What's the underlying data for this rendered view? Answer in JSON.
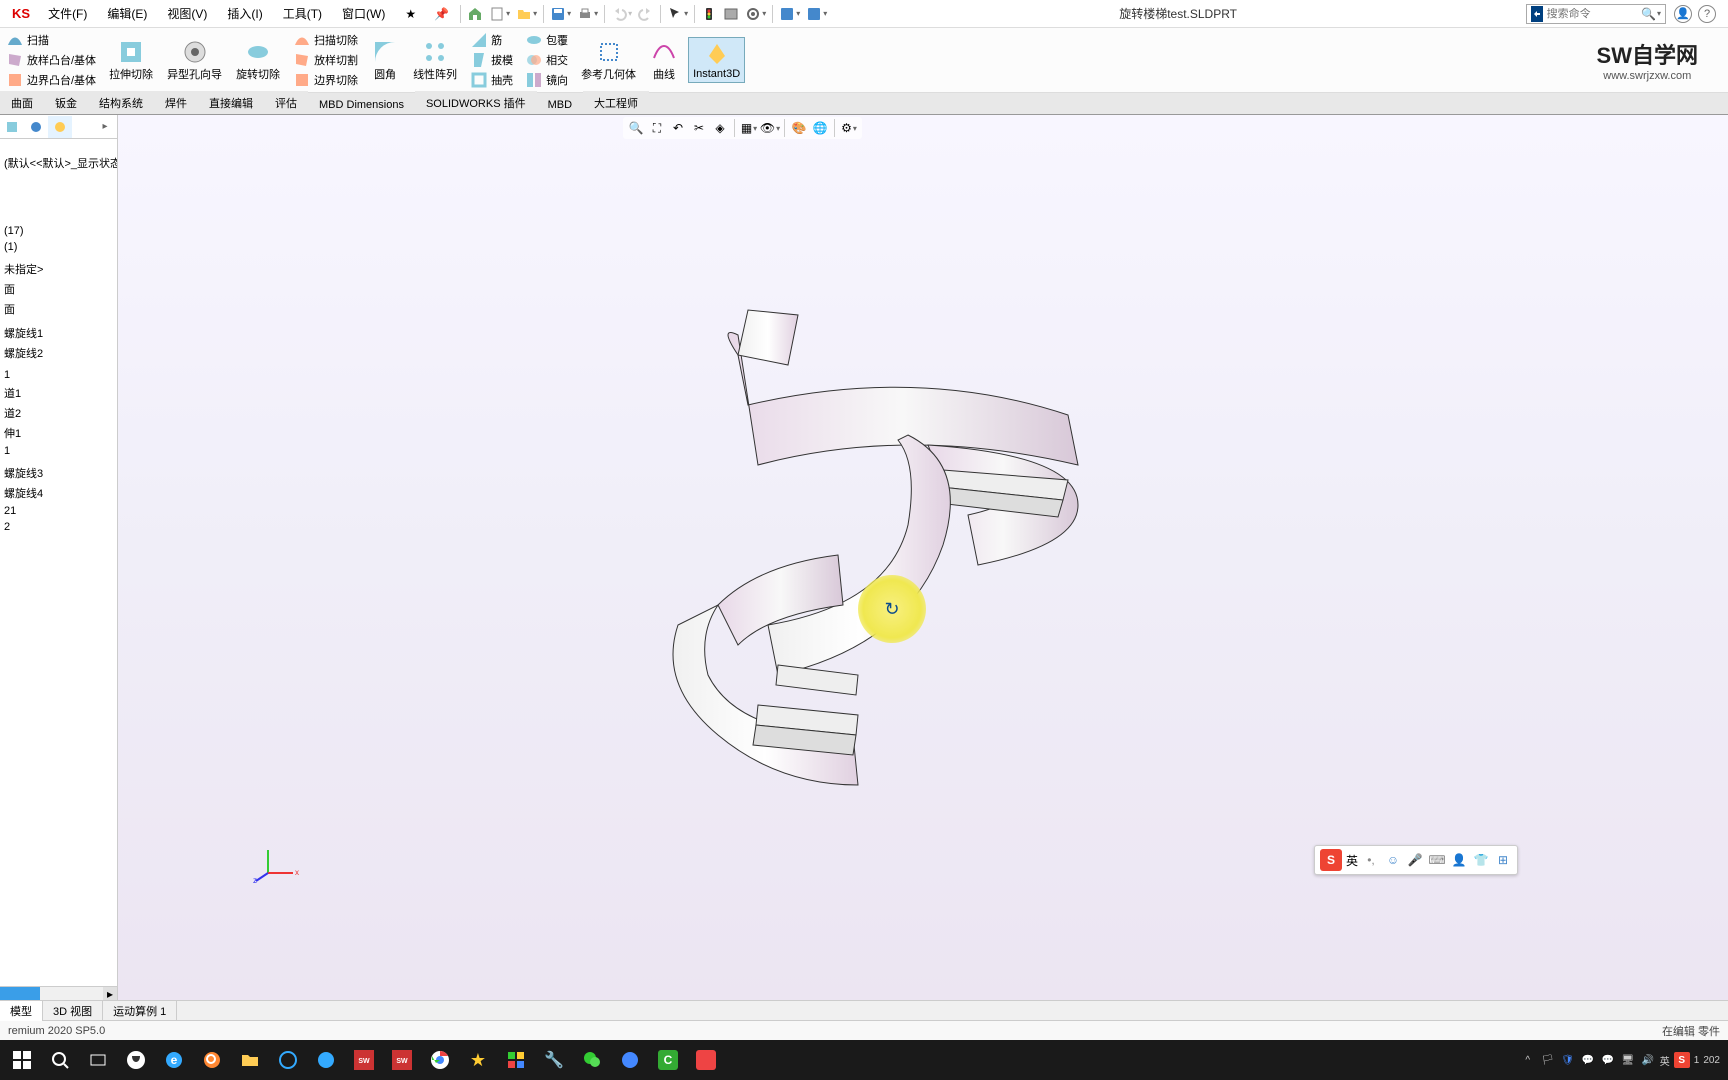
{
  "app": {
    "logo": "KS",
    "doc_title": "旋转楼梯test.SLDPRT"
  },
  "menubar": [
    "文件(F)",
    "编辑(E)",
    "视图(V)",
    "插入(I)",
    "工具(T)",
    "窗口(W)"
  ],
  "search": {
    "placeholder": "搜索命令"
  },
  "ribbon": {
    "r1c1": "扫描",
    "r1c2": "放样凸台/基体",
    "r1c3": "边界凸台/基体",
    "r2c1": "拉伸切除",
    "r2c2": "异型孔向导",
    "r2c3": "旋转切除",
    "r3c1": "扫描切除",
    "r3c2": "放样切割",
    "r3c3": "边界切除",
    "r4c1": "圆角",
    "r4c2": "线性阵列",
    "r5c1": "筋",
    "r5c2": "拔模",
    "r5c3": "抽壳",
    "r6c1": "包覆",
    "r6c2": "相交",
    "r6c3": "镜向",
    "r7": "参考几何体",
    "r8": "曲线",
    "r9": "Instant3D"
  },
  "brand": {
    "t1": "SW自学网",
    "t2": "www.swrjzxw.com"
  },
  "tabs": [
    "曲面",
    "钣金",
    "结构系统",
    "焊件",
    "直接编辑",
    "评估",
    "MBD Dimensions",
    "SOLIDWORKS 插件",
    "MBD",
    "大工程师"
  ],
  "tree": {
    "config": "(默认<<默认>_显示状态",
    "items": [
      "(17)",
      "(1)",
      "",
      "未指定>",
      "面",
      "面",
      "",
      "螺旋线1",
      "螺旋线2",
      "",
      "1",
      "道1",
      "道2",
      "伸1",
      "1",
      "",
      "螺旋线3",
      "螺旋线4",
      "21",
      "2",
      ""
    ]
  },
  "bottom_tabs": [
    "模型",
    "3D 视图",
    "运动算例 1"
  ],
  "status": {
    "left": "remium 2020 SP5.0",
    "right": "在编辑 零件"
  },
  "ime": {
    "lang": "英"
  },
  "tray": {
    "lang": "英",
    "year": "202"
  }
}
